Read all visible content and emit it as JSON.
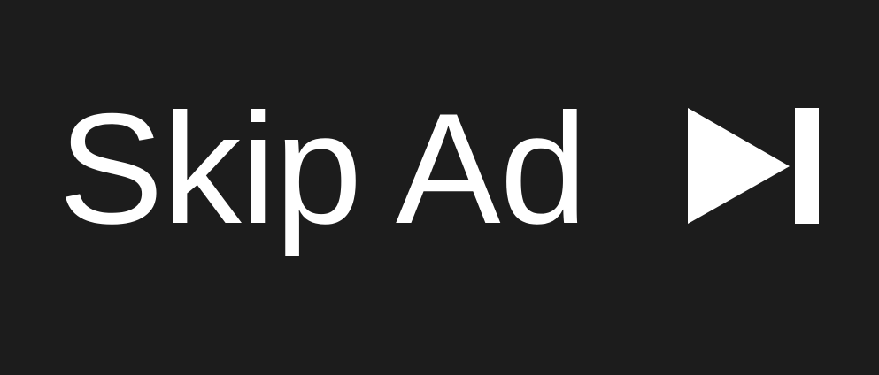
{
  "skip_ad": {
    "label": "Skip Ad",
    "icon": "skip-next-icon",
    "colors": {
      "background": "#1c1c1c",
      "foreground": "#ffffff"
    }
  }
}
